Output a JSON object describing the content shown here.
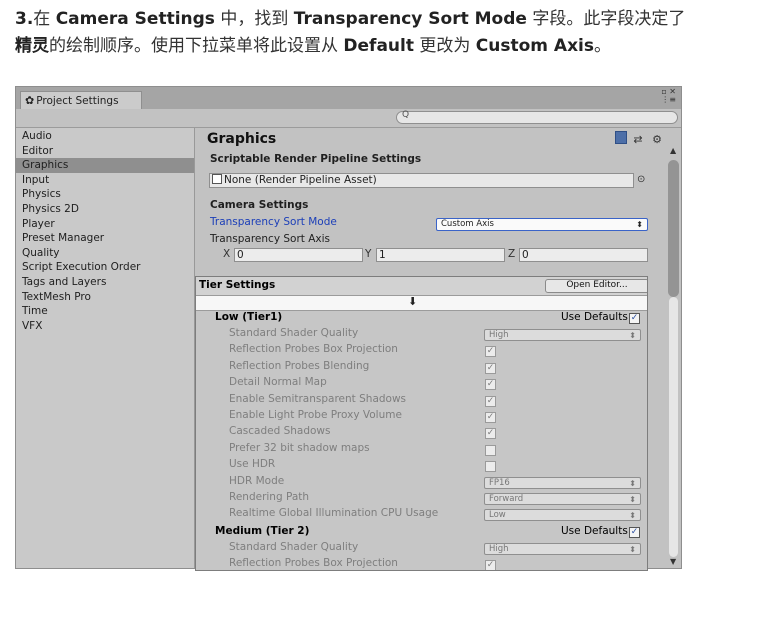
{
  "intro": {
    "step": "3.",
    "p1": "在 ",
    "camera_settings": "Camera Settings",
    "p2": " 中，找到 ",
    "transparency_sort_mode": "Transparency Sort Mode",
    "p3": " 字段。此字段决定了",
    "sprite": "精灵",
    "p4": "的绘制顺序。使用下拉菜单将此设置从 ",
    "default": "Default",
    "p5": " 更改为 ",
    "custom_axis": "Custom Axis",
    "p6": "。"
  },
  "window": {
    "tab_label": "Project Settings",
    "sidebar": [
      "Audio",
      "Editor",
      "Graphics",
      "Input",
      "Physics",
      "Physics 2D",
      "Player",
      "Preset Manager",
      "Quality",
      "Script Execution Order",
      "Tags and Layers",
      "TextMesh Pro",
      "Time",
      "VFX"
    ],
    "selected_index": 2,
    "content": {
      "title": "Graphics",
      "srp_heading": "Scriptable Render Pipeline Settings",
      "srp_value": "None (Render Pipeline Asset)",
      "camera_heading": "Camera Settings",
      "sort_mode_label": "Transparency Sort Mode",
      "sort_mode_value": "Custom Axis",
      "sort_axis_label": "Transparency Sort Axis",
      "axis": {
        "x_label": "X",
        "x": "0",
        "y_label": "Y",
        "y": "1",
        "z_label": "Z",
        "z": "0"
      }
    },
    "tier": {
      "heading": "Tier Settings",
      "open_editor": "Open Editor...",
      "low_title": "Low (Tier1)",
      "use_defaults": "Use Defaults",
      "rows": [
        {
          "label": "Standard Shader Quality",
          "type": "select",
          "value": "High"
        },
        {
          "label": "Reflection Probes Box Projection",
          "type": "check",
          "checked": true
        },
        {
          "label": "Reflection Probes Blending",
          "type": "check",
          "checked": true
        },
        {
          "label": "Detail Normal Map",
          "type": "check",
          "checked": true
        },
        {
          "label": "Enable Semitransparent Shadows",
          "type": "check",
          "checked": true
        },
        {
          "label": "Enable Light Probe Proxy Volume",
          "type": "check",
          "checked": true
        },
        {
          "label": "Cascaded Shadows",
          "type": "check",
          "checked": true
        },
        {
          "label": "Prefer 32 bit shadow maps",
          "type": "check",
          "checked": false
        },
        {
          "label": "Use HDR",
          "type": "check",
          "checked": false
        },
        {
          "label": "HDR Mode",
          "type": "select",
          "value": "FP16"
        },
        {
          "label": "Rendering Path",
          "type": "select",
          "value": "Forward"
        },
        {
          "label": "Realtime Global Illumination CPU Usage",
          "type": "select",
          "value": "Low"
        }
      ],
      "medium_title": "Medium (Tier 2)",
      "medium_rows": [
        {
          "label": "Standard Shader Quality",
          "type": "select",
          "value": "High"
        },
        {
          "label": "Reflection Probes Box Projection",
          "type": "check",
          "checked": true
        }
      ]
    }
  }
}
